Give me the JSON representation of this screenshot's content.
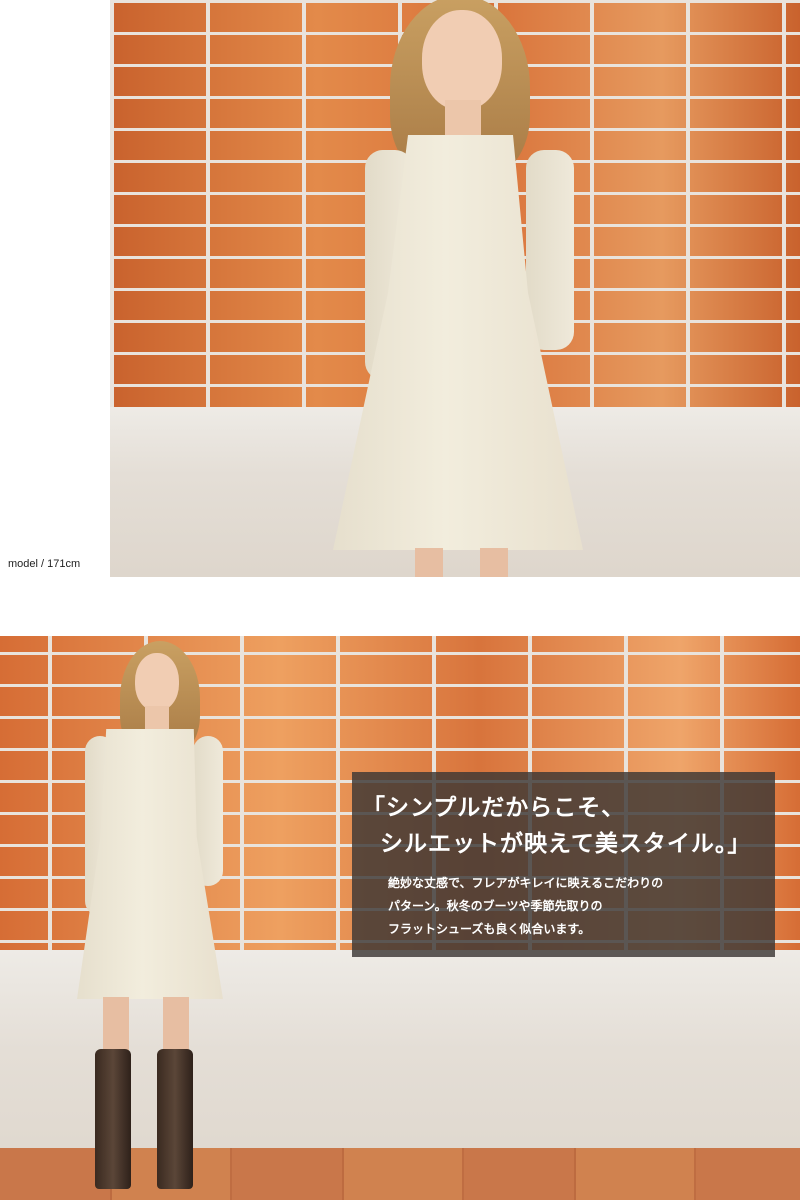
{
  "photo_top": {
    "caption": "model / 171cm"
  },
  "photo_bottom": {
    "headline": {
      "line1": "「シンプルだからこそ、",
      "line2": "シルエットが映えて美スタイル。」"
    },
    "body": [
      "絶妙な丈感で、フレアがキレイに映えるこだわりの",
      "パターン。秋冬のブーツや季節先取りの",
      "フラットシューズも良く似合います。"
    ]
  },
  "colors": {
    "brick": "#d9733a",
    "mortar": "#e9e3dc",
    "dress": "#efe9d9",
    "overlay": "#3c3734"
  }
}
